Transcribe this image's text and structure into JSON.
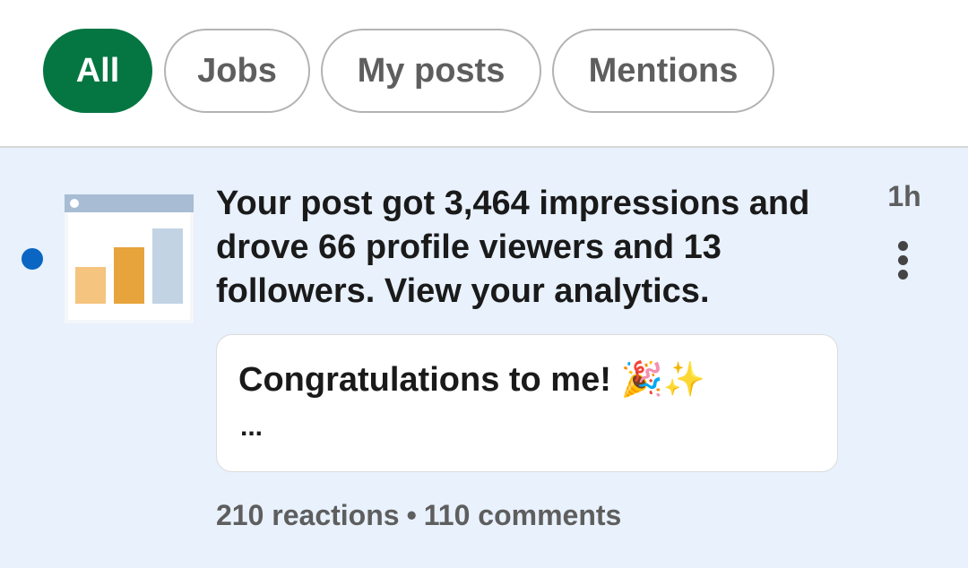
{
  "filters": {
    "chips": [
      {
        "label": "All",
        "active": true
      },
      {
        "label": "Jobs",
        "active": false
      },
      {
        "label": "My posts",
        "active": false
      },
      {
        "label": "Mentions",
        "active": false
      }
    ]
  },
  "notification": {
    "unread": true,
    "thumbnail_icon": "analytics-chart-icon",
    "message": "Your post got 3,464 impressions and drove 66 profile viewers and 13 followers. View your analytics.",
    "time": "1h",
    "menu_icon": "more-vertical-icon",
    "post_preview": {
      "text": "Congratulations to me!",
      "emoji": "🎉✨",
      "ellipsis": "..."
    },
    "reactions": "210 reactions",
    "separator": "•",
    "comments": "110 comments"
  },
  "colors": {
    "accent_green": "#057642",
    "feed_background": "#e8f1fc",
    "unread_dot": "#0a66c2",
    "bar_light": "#f5c47e",
    "bar_mid": "#e7a43c",
    "bar_blue": "#c2d3e4"
  }
}
